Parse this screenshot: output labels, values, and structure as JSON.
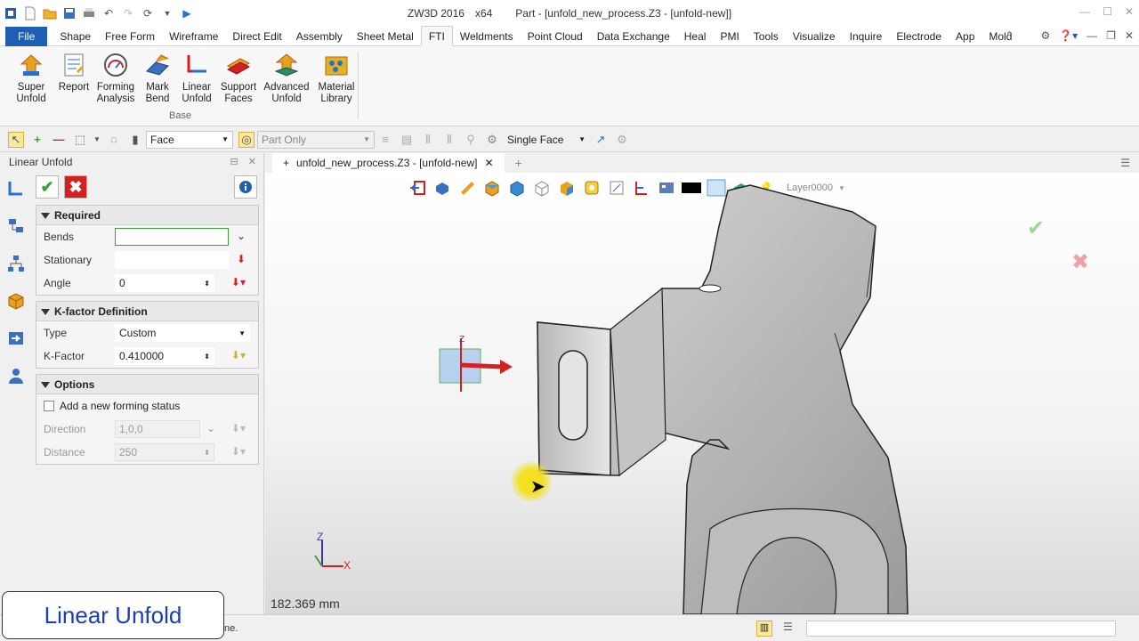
{
  "window": {
    "app": "ZW3D 2016",
    "arch": "x64",
    "doc_title": "Part - [unfold_new_process.Z3 - [unfold-new]]"
  },
  "menu": {
    "items": [
      "File",
      "Shape",
      "Free Form",
      "Wireframe",
      "Direct Edit",
      "Assembly",
      "Sheet Metal",
      "FTI",
      "Weldments",
      "Point Cloud",
      "Data Exchange",
      "Heal",
      "PMI",
      "Tools",
      "Visualize",
      "Inquire",
      "Electrode",
      "App",
      "Mold"
    ],
    "active": "FTI"
  },
  "ribbon": {
    "group_label": "Base",
    "buttons": [
      {
        "line1": "Super",
        "line2": "Unfold"
      },
      {
        "line1": "Report",
        "line2": ""
      },
      {
        "line1": "Forming",
        "line2": "Analysis"
      },
      {
        "line1": "Mark",
        "line2": "Bend"
      },
      {
        "line1": "Linear",
        "line2": "Unfold"
      },
      {
        "line1": "Support",
        "line2": "Faces"
      },
      {
        "line1": "Advanced",
        "line2": "Unfold"
      },
      {
        "line1": "Material",
        "line2": "Library"
      }
    ]
  },
  "toolstrip": {
    "filter": "Face",
    "scope": "Part Only",
    "pick_mode": "Single Face"
  },
  "panel": {
    "title": "Linear Unfold",
    "sections": {
      "required": "Required",
      "kfactor": "K-factor Definition",
      "options": "Options"
    },
    "required": {
      "bends_label": "Bends",
      "bends_value": "",
      "stationary_label": "Stationary",
      "stationary_value": "",
      "angle_label": "Angle",
      "angle_value": "0"
    },
    "kfactor": {
      "type_label": "Type",
      "type_value": "Custom",
      "kfactor_label": "K-Factor",
      "kfactor_value": "0.410000"
    },
    "options": {
      "add_status_label": "Add a new forming status",
      "add_status_checked": false,
      "direction_label": "Direction",
      "direction_value": "1,0,0",
      "distance_label": "Distance",
      "distance_value": "250"
    }
  },
  "document_tab": {
    "label": "unfold_new_process.Z3 - [unfold-new]"
  },
  "viewport": {
    "layer": "Layer0000",
    "measurement": "182.369 mm",
    "axis_x": "X",
    "axis_z": "Z"
  },
  "caption": {
    "text": "Linear  Unfold"
  },
  "status": {
    "fragment": "ne."
  },
  "colors": {
    "file_tab": "#1e5fb4",
    "accept": "#3da03d",
    "cancel": "#d42020",
    "caption_text": "#1c3fb0"
  }
}
